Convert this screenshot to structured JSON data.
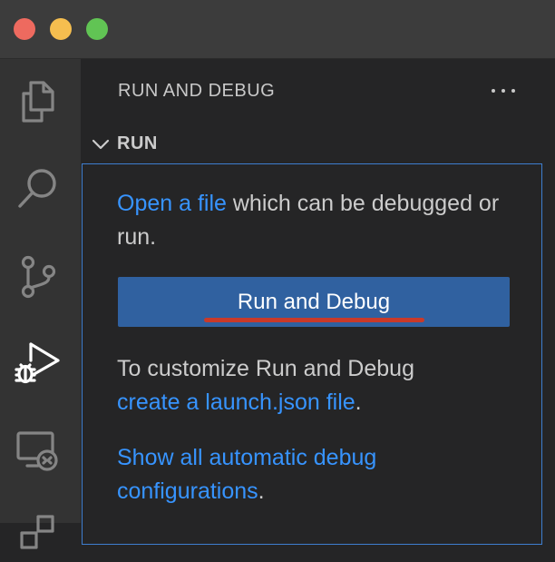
{
  "window": {
    "traffic_lights": {
      "close": "#ee6a5f",
      "minimize": "#f5be4f",
      "maximize": "#61c454"
    }
  },
  "activity_bar": {
    "icons": [
      "files-icon",
      "search-icon",
      "source-control-icon",
      "run-debug-icon",
      "remote-explorer-icon",
      "extensions-icon"
    ],
    "active": "run-debug-icon"
  },
  "sidebar": {
    "title": "RUN AND DEBUG",
    "section": {
      "label": "RUN",
      "intro_link": "Open a file",
      "intro_text": " which can be debugged or run.",
      "run_button_label": "Run and Debug",
      "customize_text": "To customize Run and Debug",
      "customize_link": "create a launch.json file",
      "customize_end": ".",
      "show_link": "Show all automatic debug configurations",
      "show_end": "."
    }
  },
  "colors": {
    "accent_link": "#3794ff",
    "button_bg": "#3061a0",
    "focus_border": "#3e7ecf",
    "annotation_underline": "#c93a2a"
  }
}
